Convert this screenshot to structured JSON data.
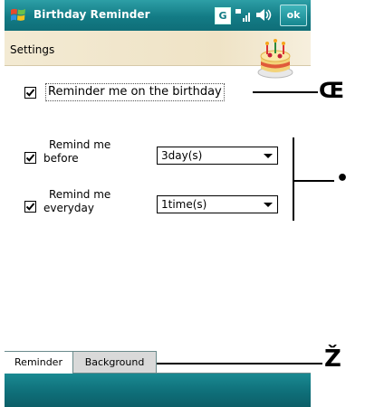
{
  "title_bar": {
    "app_title": "Birthday Reminder",
    "g_indicator": "G",
    "ok_label": "ok",
    "icons": [
      "windows-start-icon",
      "signal-icon",
      "volume-icon"
    ]
  },
  "header": {
    "title": "Settings",
    "icon": "birthday-cake-icon"
  },
  "settings": {
    "reminder_on_birthday": {
      "label": "Reminder me on the birthday",
      "checked": true
    },
    "remind_before": {
      "label_line1": "Remind me",
      "label_line2": "before",
      "checked": true,
      "value": "3day(s)"
    },
    "remind_everyday": {
      "label_line1": "Remind me",
      "label_line2": "everyday",
      "checked": true,
      "value": "1time(s)"
    }
  },
  "tabs": [
    {
      "label": "Reminder",
      "active": true
    },
    {
      "label": "Background",
      "active": false
    }
  ],
  "callouts": {
    "mark_1": "Œ",
    "mark_2": "•",
    "mark_3": "Ž"
  },
  "colors": {
    "title_bar": "#137b85",
    "header_band": "#efe3c6",
    "menu_bar": "#0f6f79"
  }
}
